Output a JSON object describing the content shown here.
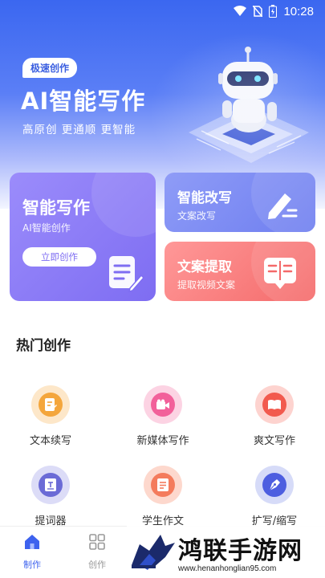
{
  "status_bar": {
    "time": "10:28"
  },
  "hero": {
    "badge": "极速创作",
    "title": "AI智能写作",
    "subtitle": "高原创 更通顺 更智能"
  },
  "cards": {
    "smart_write": {
      "title": "智能写作",
      "desc": "AI智能创作",
      "button": "立即创作",
      "icon": "document-edit-icon"
    },
    "rewrite": {
      "title": "智能改写",
      "desc": "文案改写",
      "icon": "pencil-icon"
    },
    "extract": {
      "title": "文案提取",
      "desc": "提取视频文案",
      "icon": "book-icon"
    }
  },
  "section": {
    "title": "热门创作"
  },
  "hot_items": [
    {
      "label": "文本续写",
      "icon": "file-edit-icon",
      "color": "#f4a63c",
      "bg": "#fde7c9"
    },
    {
      "label": "新媒体写作",
      "icon": "video-camera-icon",
      "color": "#f2609a",
      "bg": "#fcd3e3"
    },
    {
      "label": "爽文写作",
      "icon": "open-book-icon",
      "color": "#f25a4e",
      "bg": "#fdd3cf"
    },
    {
      "label": "提词器",
      "icon": "teleprompter-icon",
      "color": "#6b6bd6",
      "bg": "#dcdcf7"
    },
    {
      "label": "学生作文",
      "icon": "essay-icon",
      "color": "#f47b5c",
      "bg": "#fdd8cd"
    },
    {
      "label": "扩写/缩写",
      "icon": "pen-nib-icon",
      "color": "#4d5ee0",
      "bg": "#d6dbf8"
    }
  ],
  "tabs": [
    {
      "label": "制作",
      "icon": "home-icon",
      "active": true
    },
    {
      "label": "创作",
      "icon": "grid-icon",
      "active": false
    }
  ],
  "watermark": {
    "title": "鸿联手游网",
    "url": "www.henanhonglian95.com"
  }
}
